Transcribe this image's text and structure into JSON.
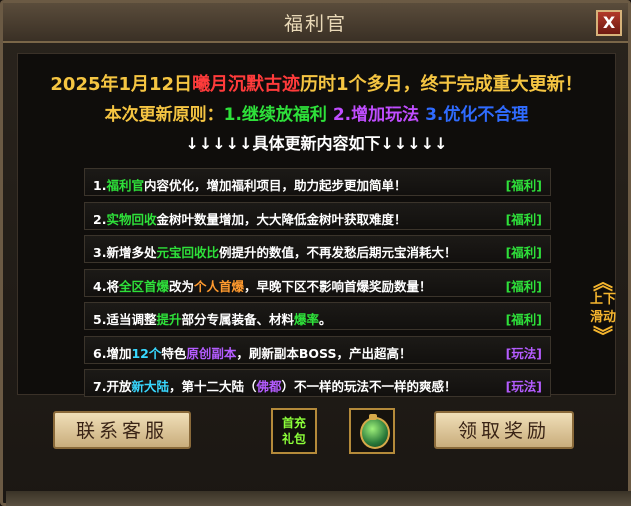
{
  "window": {
    "title": "福利官",
    "close_label": "X"
  },
  "headline": {
    "line1_a": "2025年1月12日",
    "line1_highlight": "曦月沉默古迹",
    "line1_b": "历时1个多月，终于完成重大更新！",
    "line2_a": "本次更新原则：",
    "line2_g": "1.继续放福利",
    "line2_p": "2.增加玩法",
    "line2_b": "3.优化不合理",
    "line3": "↓↓↓↓↓具体更新内容如下↓↓↓↓↓"
  },
  "updates": [
    {
      "parts": [
        [
          "1.",
          ""
        ],
        [
          "福利官",
          "green"
        ],
        [
          "内容优化，增加福利项目，助力起步更加简单！",
          ""
        ]
      ],
      "tag": "[福利]",
      "tag_color": "green"
    },
    {
      "parts": [
        [
          "2.",
          ""
        ],
        [
          "实物回收",
          "green"
        ],
        [
          "金树叶数量增加，大大降低金树叶获取难度！",
          ""
        ]
      ],
      "tag": "[福利]",
      "tag_color": "green"
    },
    {
      "parts": [
        [
          "3.新增多处",
          ""
        ],
        [
          "元宝回收比",
          "green"
        ],
        [
          "例提升的数值，不再发愁后期元宝消耗大！",
          ""
        ]
      ],
      "tag": "[福利]",
      "tag_color": "green"
    },
    {
      "parts": [
        [
          "4.将",
          ""
        ],
        [
          "全区首爆",
          "green"
        ],
        [
          "改为",
          ""
        ],
        [
          "个人首爆",
          "orange"
        ],
        [
          "，早晚下区不影响首爆奖励数量！",
          ""
        ]
      ],
      "tag": "[福利]",
      "tag_color": "green"
    },
    {
      "parts": [
        [
          "5.适当调整",
          ""
        ],
        [
          "提升",
          "green"
        ],
        [
          "部分专属装备、材料",
          ""
        ],
        [
          "爆率",
          "green"
        ],
        [
          "。",
          ""
        ]
      ],
      "tag": "[福利]",
      "tag_color": "green"
    },
    {
      "parts": [
        [
          "6.增加",
          ""
        ],
        [
          "12个",
          "cyan"
        ],
        [
          "特色",
          ""
        ],
        [
          "原创副本",
          "purple"
        ],
        [
          "，刷新副本BOSS，产出超高！",
          ""
        ]
      ],
      "tag": "[玩法]",
      "tag_color": "purple"
    },
    {
      "parts": [
        [
          "7.开放",
          ""
        ],
        [
          "新大陆",
          "cyan"
        ],
        [
          "，第十二大陆（",
          ""
        ],
        [
          "佛都",
          "purple"
        ],
        [
          "）不一样的玩法不一样的爽感！",
          ""
        ]
      ],
      "tag": "[玩法]",
      "tag_color": "purple"
    }
  ],
  "scroll_hint": {
    "line1": "上下",
    "line2": "滑动"
  },
  "buttons": {
    "contact": "联系客服",
    "claim": "领取奖励"
  },
  "gift": {
    "line1": "首充",
    "line2": "礼包"
  },
  "icons": {
    "close": "close-icon",
    "scroll": "chevron-icon",
    "bag": "lucky-bag-icon"
  }
}
